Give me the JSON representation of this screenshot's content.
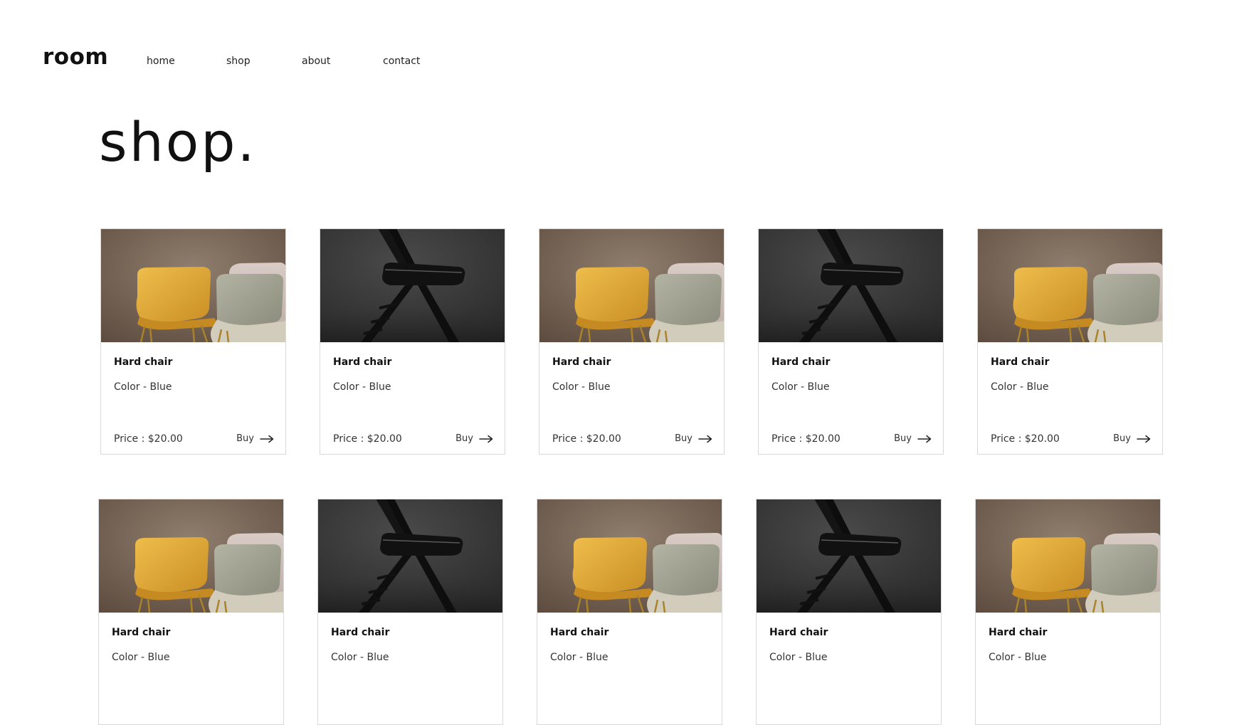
{
  "header": {
    "logo": "room",
    "nav": [
      {
        "label": "home"
      },
      {
        "label": "shop"
      },
      {
        "label": "about"
      },
      {
        "label": "contact"
      }
    ]
  },
  "page": {
    "title": "shop."
  },
  "products": [
    {
      "image": "yellow-and-grey-chairs-photo",
      "title": "Hard chair",
      "color_label": "Color - Blue",
      "price_label": "Price : $20.00",
      "buy_label": "Buy"
    },
    {
      "image": "black-folding-chair-photo",
      "title": "Hard chair",
      "color_label": "Color - Blue",
      "price_label": "Price : $20.00",
      "buy_label": "Buy"
    },
    {
      "image": "yellow-and-grey-chairs-photo",
      "title": "Hard chair",
      "color_label": "Color - Blue",
      "price_label": "Price : $20.00",
      "buy_label": "Buy"
    },
    {
      "image": "black-folding-chair-photo",
      "title": "Hard chair",
      "color_label": "Color - Blue",
      "price_label": "Price : $20.00",
      "buy_label": "Buy"
    },
    {
      "image": "yellow-and-grey-chairs-photo",
      "title": "Hard chair",
      "color_label": "Color - Blue",
      "price_label": "Price : $20.00",
      "buy_label": "Buy"
    },
    {
      "image": "yellow-and-grey-chairs-photo",
      "title": "Hard chair",
      "color_label": "Color - Blue"
    },
    {
      "image": "black-folding-chair-photo",
      "title": "Hard chair",
      "color_label": "Color - Blue"
    },
    {
      "image": "yellow-and-grey-chairs-photo",
      "title": "Hard chair",
      "color_label": "Color - Blue"
    },
    {
      "image": "black-folding-chair-photo",
      "title": "Hard chair",
      "color_label": "Color - Blue"
    },
    {
      "image": "yellow-and-grey-chairs-photo",
      "title": "Hard chair",
      "color_label": "Color - Blue"
    }
  ],
  "colors": {
    "page_background": "#ffffff",
    "text": "#1a1a1a",
    "card_border": "#d9d9d9",
    "chair_yellow": "#e1a838",
    "chair_grey": "#a3a493",
    "warm_backdrop": "#7d6a5a",
    "dark_backdrop": "#3a3a3a"
  }
}
